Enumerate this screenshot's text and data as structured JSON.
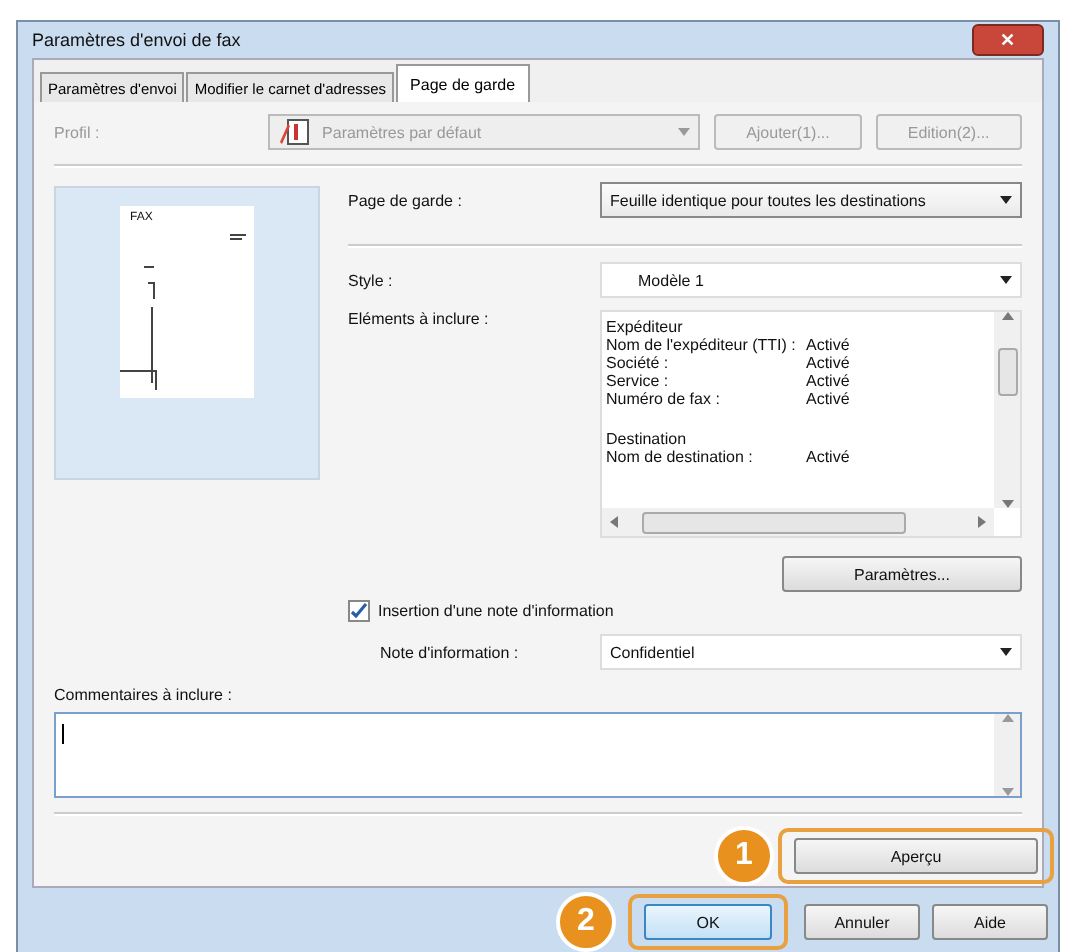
{
  "window": {
    "title": "Paramètres d'envoi de fax",
    "close": "✕"
  },
  "tabs": [
    {
      "label": "Paramètres d'envoi",
      "selected": false
    },
    {
      "label": "Modifier le carnet d'adresses",
      "selected": false
    },
    {
      "label": "Page de garde",
      "selected": true
    }
  ],
  "profile": {
    "label": "Profil :",
    "value": "Paramètres par défaut",
    "disabled": true,
    "buttons": [
      "Ajouter(1)...",
      "Edition(2)..."
    ]
  },
  "preview": {
    "header": "FAX"
  },
  "cover_page": {
    "label": "Page de garde :",
    "value": "Feuille identique pour toutes les destinations"
  },
  "style": {
    "label": "Style :",
    "value": "Modèle 1"
  },
  "elements": {
    "label": "Eléments à inclure :",
    "rows": [
      {
        "kind": "group",
        "name": "Expéditeur",
        "value": ""
      },
      {
        "name": "Nom de l'expéditeur (TTI) :",
        "value": "Activé"
      },
      {
        "name": "Société :",
        "value": "Activé"
      },
      {
        "name": "Service :",
        "value": "Activé"
      },
      {
        "name": "Numéro de fax :",
        "value": "Activé"
      },
      {
        "kind": "group",
        "name": "Destination",
        "value": ""
      },
      {
        "name": "Nom de destination :",
        "value": "Activé"
      }
    ],
    "settings_button": "Paramètres..."
  },
  "info_note": {
    "checkbox_label": "Insertion d'une note d'information",
    "checked": true,
    "label": "Note d'information :",
    "value": "Confidentiel"
  },
  "comments": {
    "label": "Commentaires à inclure :"
  },
  "preview_button": {
    "label": "Aperçu",
    "callout": "1"
  },
  "footer_buttons": [
    {
      "label": "OK",
      "callout": "2",
      "default": true
    },
    {
      "label": "Annuler",
      "default": false
    },
    {
      "label": "Aide",
      "default": false
    }
  ]
}
